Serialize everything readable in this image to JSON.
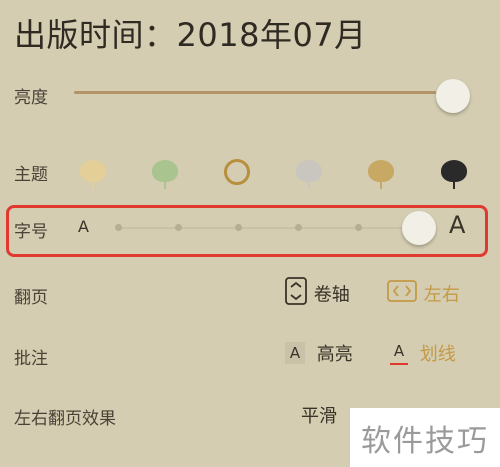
{
  "header": {
    "title": "出版时间：2018年07月"
  },
  "brightness": {
    "label": "亮度",
    "level": 1.0
  },
  "theme": {
    "label": "主题",
    "swatches": [
      {
        "name": "yellow-swatch",
        "color": "#e3cf97"
      },
      {
        "name": "green-swatch",
        "color": "#a9c48e"
      },
      {
        "name": "selected-swatch",
        "color": "#b78f3d"
      },
      {
        "name": "gray-swatch",
        "color": "#c9c6bf"
      },
      {
        "name": "tan-swatch",
        "color": "#c8a964"
      },
      {
        "name": "night-swatch",
        "color": "#2a2a2a"
      }
    ]
  },
  "font_size": {
    "label": "字号",
    "small_glyph": "A",
    "large_glyph": "A",
    "steps": 6,
    "selected_step": 6
  },
  "page_turn": {
    "label": "翻页",
    "option1": "卷轴",
    "option2": "左右"
  },
  "annotation": {
    "label": "批注",
    "option1_glyph": "A",
    "option1": "高亮",
    "option2_glyph": "A",
    "option2": "划线"
  },
  "turn_effect": {
    "label": "左右翻页效果",
    "value": "平滑"
  },
  "watermark": {
    "text": "软件技巧"
  },
  "colors": {
    "background": "#d4cdb1",
    "accent_gold": "#c49a45",
    "highlight_red": "#e03a30"
  }
}
